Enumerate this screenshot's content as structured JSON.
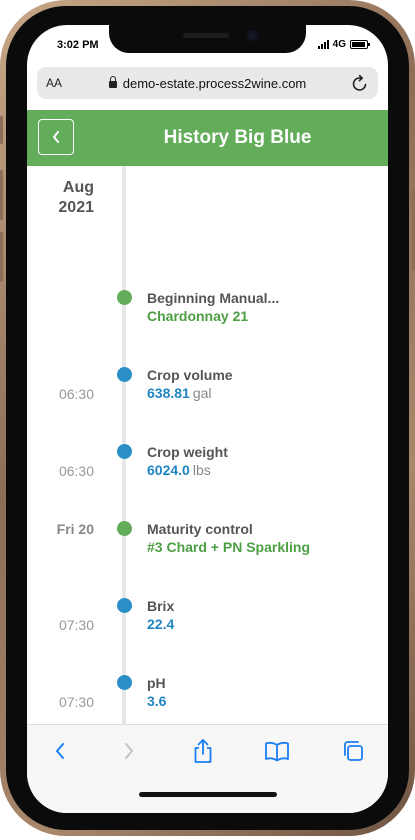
{
  "status_bar": {
    "time": "3:02 PM",
    "network": "4G"
  },
  "browser": {
    "text_size_label": "AA",
    "url": "demo-estate.process2wine.com"
  },
  "header": {
    "title": "History Big Blue"
  },
  "timeline": {
    "month_label": "Aug",
    "year_label": "2021",
    "entries": [
      {
        "title": "Beginning Manual...",
        "value": "Chardonnay 21",
        "unit": "",
        "date": "",
        "time": "",
        "color": "green"
      },
      {
        "title": "Crop volume",
        "value": "638.81",
        "unit": "gal",
        "date": "",
        "time": "06:30",
        "color": "blue"
      },
      {
        "title": "Crop weight",
        "value": "6024.0",
        "unit": "lbs",
        "date": "",
        "time": "06:30",
        "color": "blue"
      },
      {
        "title": "Maturity control",
        "value": "#3 Chard + PN Sparkling",
        "unit": "",
        "date": "Fri 20",
        "time": "",
        "color": "green"
      },
      {
        "title": "Brix",
        "value": "22.4",
        "unit": "",
        "date": "",
        "time": "07:30",
        "color": "blue"
      },
      {
        "title": "pH",
        "value": "3.6",
        "unit": "",
        "date": "",
        "time": "07:30",
        "color": "blue"
      }
    ]
  },
  "colors": {
    "header_green": "#63ad5a",
    "value_green": "#4d9f43",
    "value_blue": "#1f86c2",
    "ios_blue": "#1a7ef5"
  },
  "icons": {
    "back": "chevron-left-icon",
    "lock": "lock-icon",
    "reload": "reload-icon",
    "nav_back": "arrow-back-icon",
    "nav_forward": "arrow-forward-icon",
    "share": "share-icon",
    "bookmarks": "bookmarks-icon",
    "tabs": "tabs-icon"
  }
}
